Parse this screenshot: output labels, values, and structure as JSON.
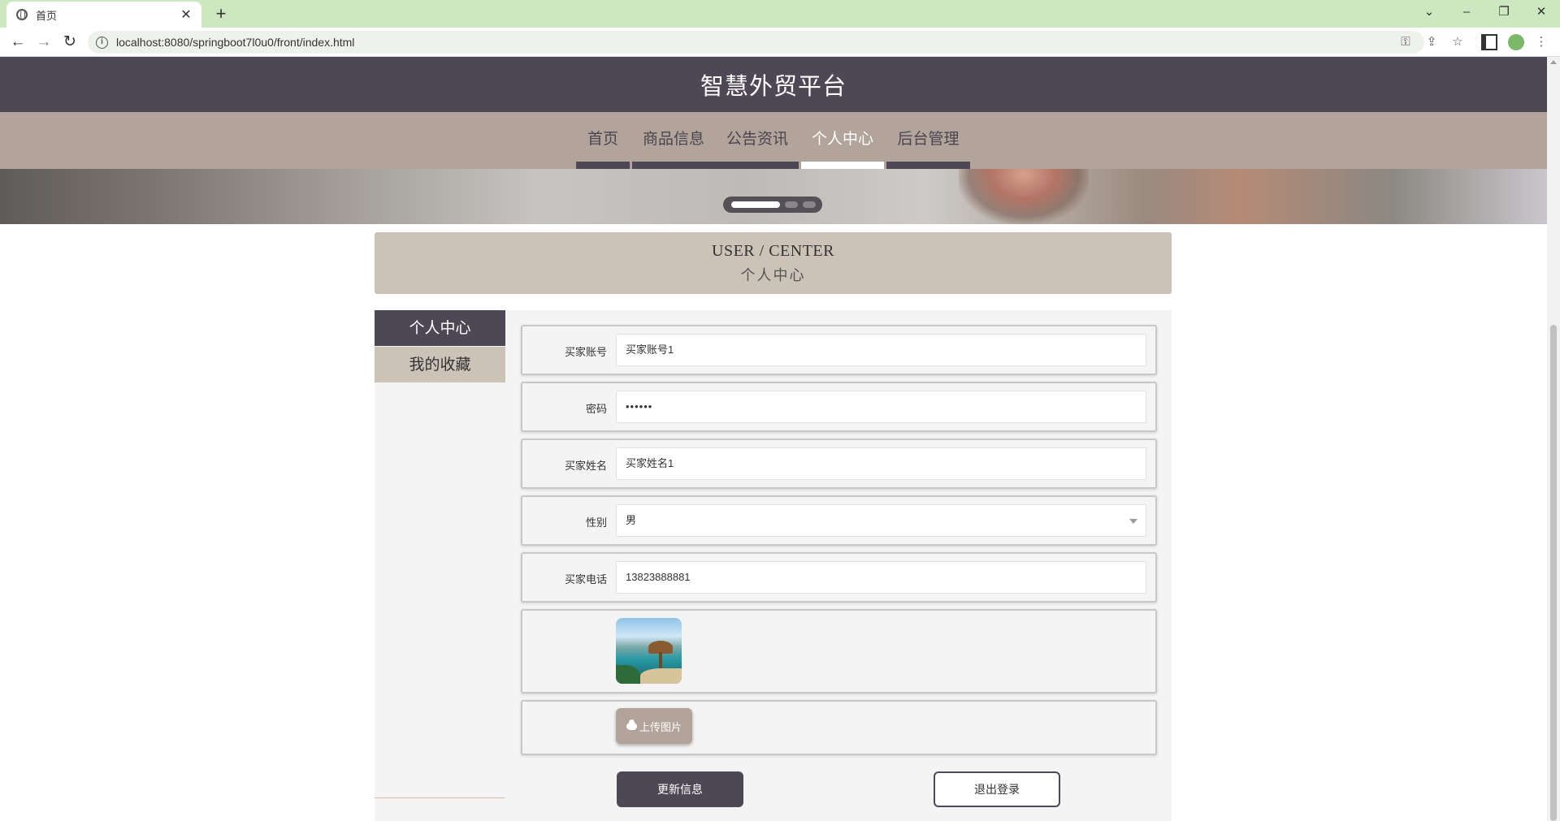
{
  "browser": {
    "tab_title": "首页",
    "url": "localhost:8080/springboot7l0u0/front/index.html"
  },
  "site": {
    "title": "智慧外贸平台"
  },
  "nav": {
    "items": [
      {
        "label": "首页"
      },
      {
        "label": "商品信息"
      },
      {
        "label": "公告资讯"
      },
      {
        "label": "个人中心"
      },
      {
        "label": "后台管理"
      }
    ],
    "active_index": 3
  },
  "banner": {
    "dot_count": 3,
    "active_dot": 0
  },
  "user_center": {
    "title_en": "USER / CENTER",
    "title_cn": "个人中心"
  },
  "sidebar": {
    "items": [
      {
        "label": "个人中心"
      },
      {
        "label": "我的收藏"
      }
    ]
  },
  "form": {
    "account_label": "买家账号",
    "account_value": "买家账号1",
    "password_label": "密码",
    "password_value": "••••••",
    "name_label": "买家姓名",
    "name_value": "买家姓名1",
    "gender_label": "性别",
    "gender_value": "男",
    "phone_label": "买家电话",
    "phone_value": "13823888881",
    "upload_label": "上传图片",
    "update_label": "更新信息",
    "logout_label": "退出登录"
  },
  "colors": {
    "header": "#4e4756",
    "nav": "#b3a49b",
    "section_header": "#cdc2b8"
  }
}
